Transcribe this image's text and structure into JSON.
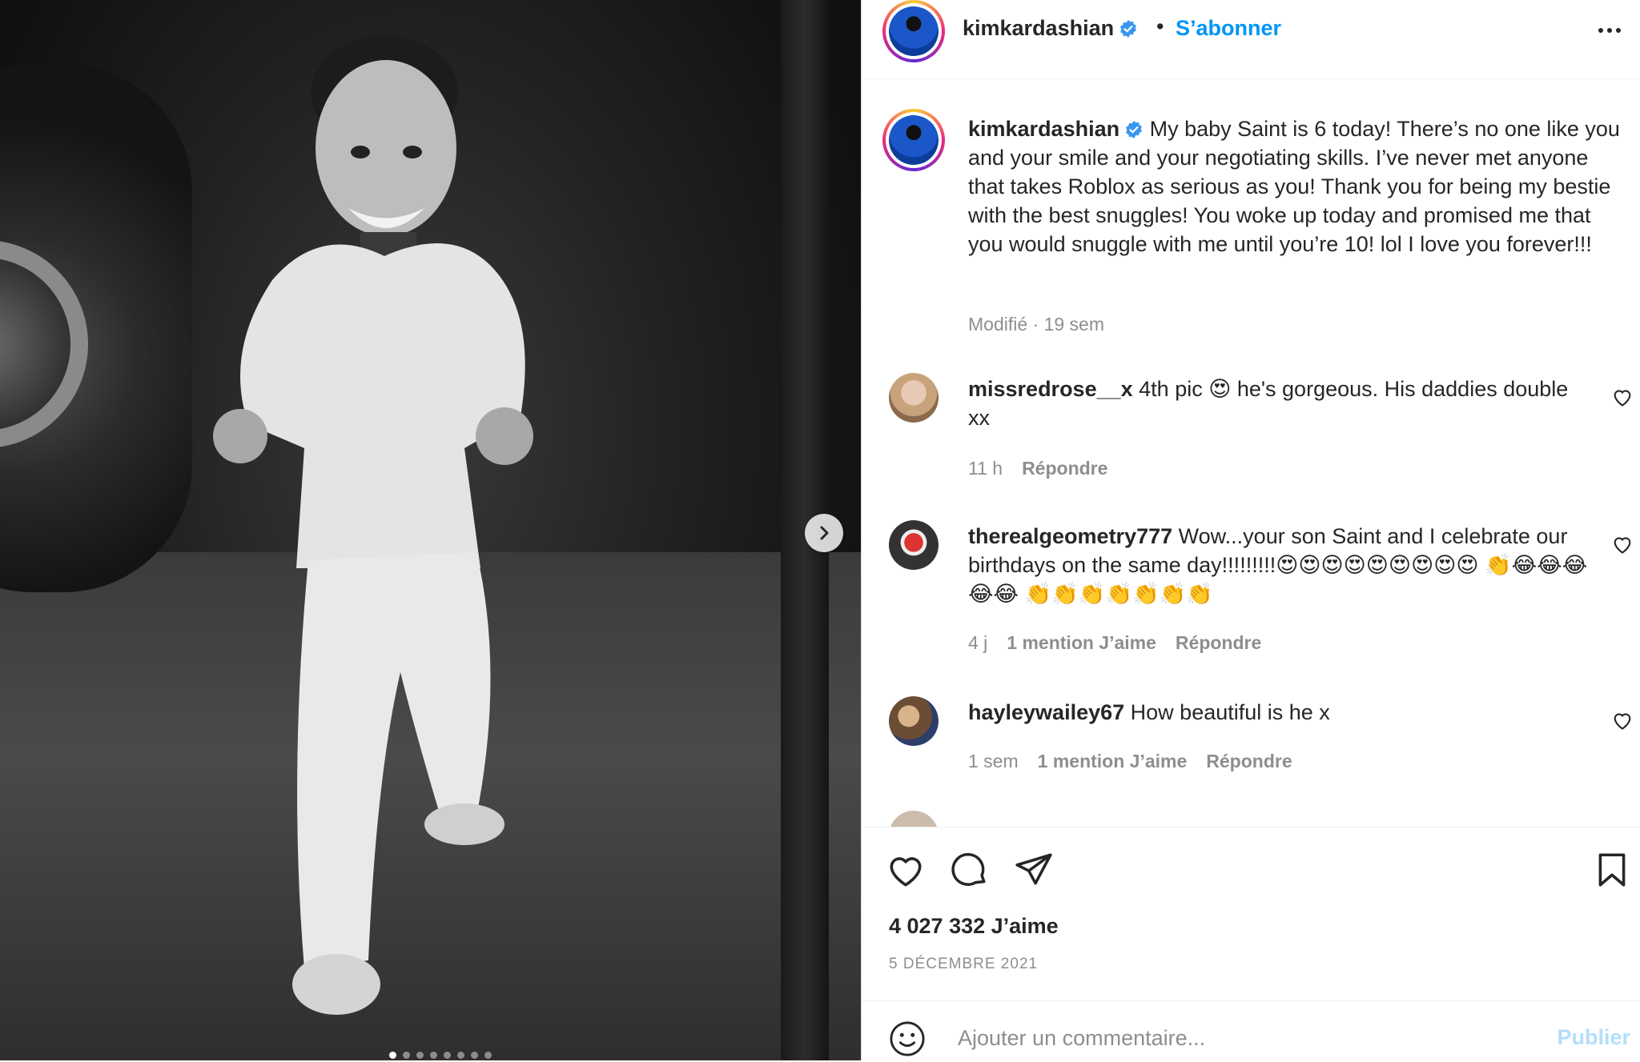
{
  "post": {
    "username": "kimkardashian",
    "follow_label": "S’abonner",
    "separator": "•",
    "caption": "My baby Saint is 6 today! There’s no one like you and your smile and your negotiating skills. I’ve never met anyone that takes Roblox as serious as you! Thank you for being my bestie with the best snuggles! You woke up today and promised me that you would snuggle with me until you’re 10! lol I love you forever!!!",
    "caption_meta": "Modifié · 19 sem",
    "media": {
      "slides_total": 8,
      "active_slide": 1
    }
  },
  "comments": [
    {
      "username": "missredrose__x",
      "text": "4th pic 😍 he's gorgeous. His daddies double xx",
      "time": "11 h",
      "likes": "",
      "reply": "Répondre"
    },
    {
      "username": "therealgeometry777",
      "text": "Wow...your son Saint and I celebrate our birthdays on the same day!!!!!!!!!😍😍😍😍😍😍😍😍😍 👏😂😂😂😂😂 👏👏👏👏👏👏👏",
      "time": "4 j",
      "likes": "1 mention J’aime",
      "reply": "Répondre"
    },
    {
      "username": "hayleywailey67",
      "text": "How beautiful is he x",
      "time": "1 sem",
      "likes": "1 mention J’aime",
      "reply": "Répondre"
    }
  ],
  "footer": {
    "likes_count": "4 027 332 J’aime",
    "date": "5 DÉCEMBRE 2021",
    "add_comment_placeholder": "Ajouter un commentaire...",
    "publish_label": "Publier"
  },
  "colors": {
    "accent": "#0095f6",
    "verified": "#3897f0",
    "muted": "#8e8e8e",
    "publish_disabled": "#b2dffc"
  },
  "icons": [
    "chevron-right-icon",
    "more-icon",
    "verified-icon",
    "heart-icon",
    "comment-icon",
    "share-icon",
    "bookmark-icon",
    "smile-icon"
  ]
}
